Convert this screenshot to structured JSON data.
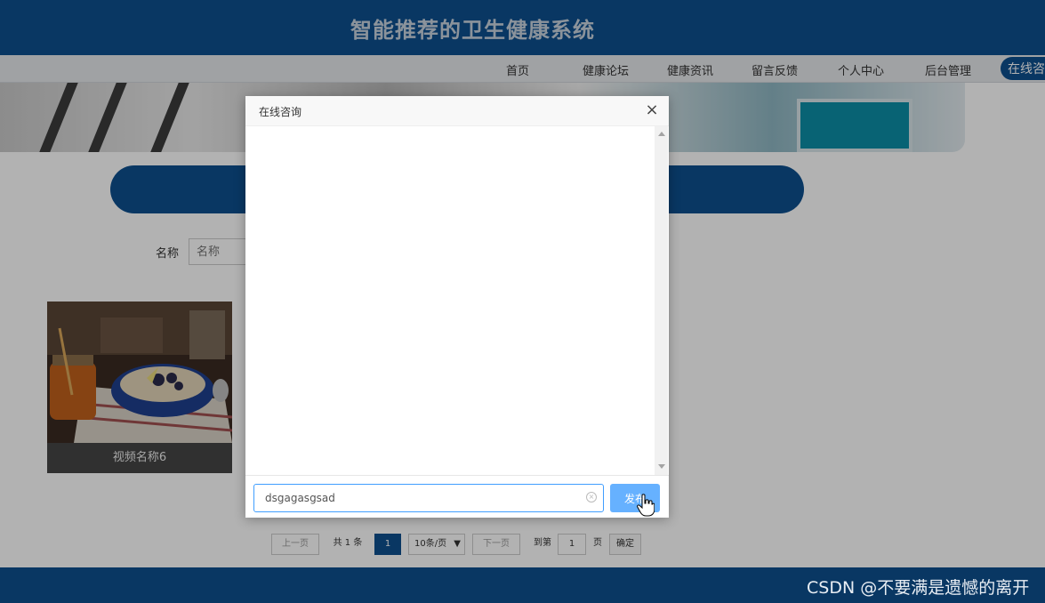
{
  "header": {
    "title": "智能推荐的卫生健康系统"
  },
  "nav": {
    "items": [
      {
        "label": "首页"
      },
      {
        "label": "健康论坛"
      },
      {
        "label": "健康资讯"
      },
      {
        "label": "留言反馈"
      },
      {
        "label": "个人中心"
      },
      {
        "label": "后台管理"
      },
      {
        "label": "在线咨"
      }
    ]
  },
  "search": {
    "label": "名称",
    "placeholder": "名称"
  },
  "videos": [
    {
      "title": "视频名称6"
    }
  ],
  "pagination": {
    "prev": "上一页",
    "total": "共 1 条",
    "current": "1",
    "page_size": "10条/页",
    "next": "下一页",
    "goto_label": "到第",
    "goto_value": "1",
    "page_unit": "页",
    "confirm": "确定"
  },
  "dialog": {
    "title": "在线咨询",
    "close": "×",
    "input_value": "dsgagasgsad",
    "send_label": "发布"
  },
  "watermark": "CSDN @不要满是遗憾的离开",
  "colors": {
    "primary": "#0e4f8f",
    "send_button": "#66b1ff",
    "input_border": "#409eff"
  }
}
